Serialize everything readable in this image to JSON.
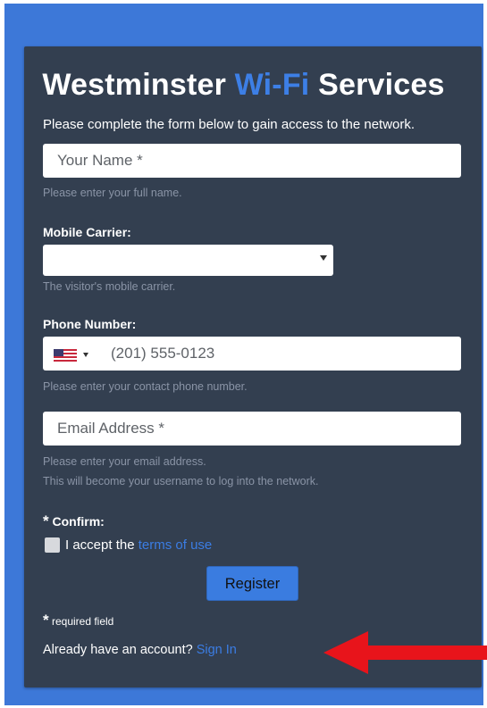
{
  "header": {
    "title_part1": "Westminster",
    "title_accent": "Wi-Fi",
    "title_part2": "Services",
    "intro": "Please complete the form below to gain access to the network."
  },
  "form": {
    "name": {
      "placeholder": "Your Name *",
      "hint": "Please enter your full name."
    },
    "carrier": {
      "label": "Mobile Carrier:",
      "value": "",
      "hint": "The visitor's mobile carrier."
    },
    "phone": {
      "label": "Phone Number:",
      "country": "us-flag-icon",
      "placeholder": "(201) 555-0123",
      "hint": "Please enter your contact phone number."
    },
    "email": {
      "placeholder": "Email Address *",
      "hint_line1": "Please enter your email address.",
      "hint_line2": "This will become your username to log into the network."
    },
    "confirm": {
      "star": "*",
      "label": "Confirm:",
      "accept_text": "I accept the",
      "terms_link": "terms of use"
    },
    "register_label": "Register",
    "required_star": "*",
    "required_note": "required field",
    "already_text": "Already have an account?",
    "sign_in_link": "Sign In"
  },
  "colors": {
    "outer_background": "#3d78d8",
    "card_background": "#333f50",
    "accent": "#3b7de4",
    "arrow": "#e8141b"
  }
}
